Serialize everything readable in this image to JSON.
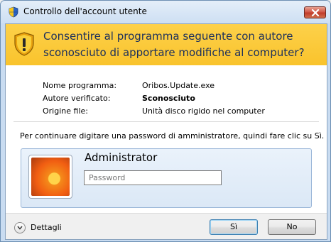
{
  "window": {
    "title": "Controllo dell'account utente"
  },
  "banner": {
    "message": "Consentire al programma seguente con autore sconosciuto di apportare modifiche al computer?"
  },
  "details": [
    {
      "label": "Nome programma:",
      "value": "Oribos.Update.exe",
      "bold": false
    },
    {
      "label": "Autore verificato:",
      "value": "Sconosciuto",
      "bold": true
    },
    {
      "label": "Origine file:",
      "value": "Unità disco rigido nel computer",
      "bold": false
    }
  ],
  "credentials": {
    "instruction": "Per continuare digitare una password di amministratore, quindi fare clic su Sì.",
    "username": "Administrator",
    "password_value": "",
    "password_placeholder": "Password"
  },
  "footer": {
    "details_label": "Dettagli",
    "yes_label": "Sì",
    "no_label": "No"
  },
  "colors": {
    "banner": "#fccc3f",
    "banner_text": "#1b2f5c",
    "close_button": "#c13b2a"
  }
}
